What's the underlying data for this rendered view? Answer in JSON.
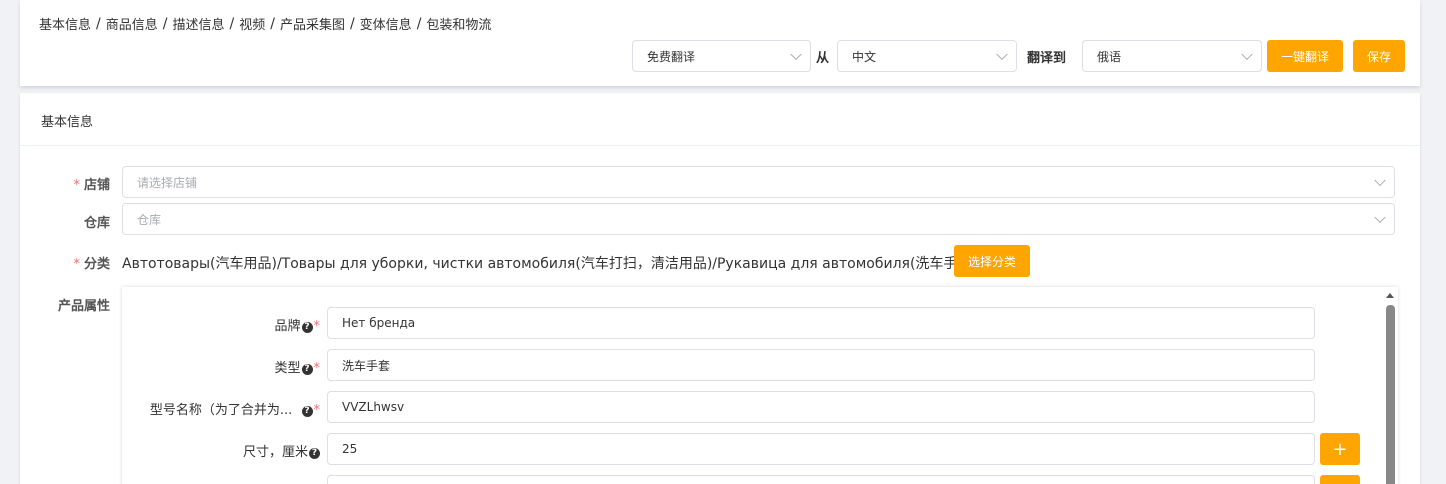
{
  "breadcrumb": [
    "基本信息",
    "商品信息",
    "描述信息",
    "视频",
    "产品采集图",
    "变体信息",
    "包装和物流"
  ],
  "translate": {
    "engine": "免费翻译",
    "from_label": "从",
    "source_lang": "中文",
    "to_label": "翻译到",
    "target_lang": "俄语",
    "translate_button": "一键翻译",
    "save_button": "保存"
  },
  "section": {
    "title": "基本信息"
  },
  "form": {
    "store_label": "店铺",
    "store_placeholder": "请选择店铺",
    "warehouse_label": "仓库",
    "warehouse_placeholder": "仓库",
    "category_label": "分类",
    "category_value": "Автотовары(汽车用品)/Товары для уборки, чистки автомобиля(汽车打扫，清洁用品)/Рукавица для автомобиля(洗车手套)",
    "category_button": "选择分类",
    "attributes_label": "产品属性",
    "required_mark": "*"
  },
  "attributes": [
    {
      "label": "品牌",
      "value": "Нет бренда",
      "required": true
    },
    {
      "label": "类型",
      "value": "洗车手套",
      "required": true
    },
    {
      "label": "型号名称（为了合并为...",
      "value": "VVZLhwsv",
      "required": true
    },
    {
      "label": "尺寸，厘米",
      "value": "25",
      "required": false
    }
  ],
  "help_glyph": "?",
  "plus_glyph": "+",
  "colors": {
    "accent": "#ffa500",
    "required": "#f56c6c"
  }
}
